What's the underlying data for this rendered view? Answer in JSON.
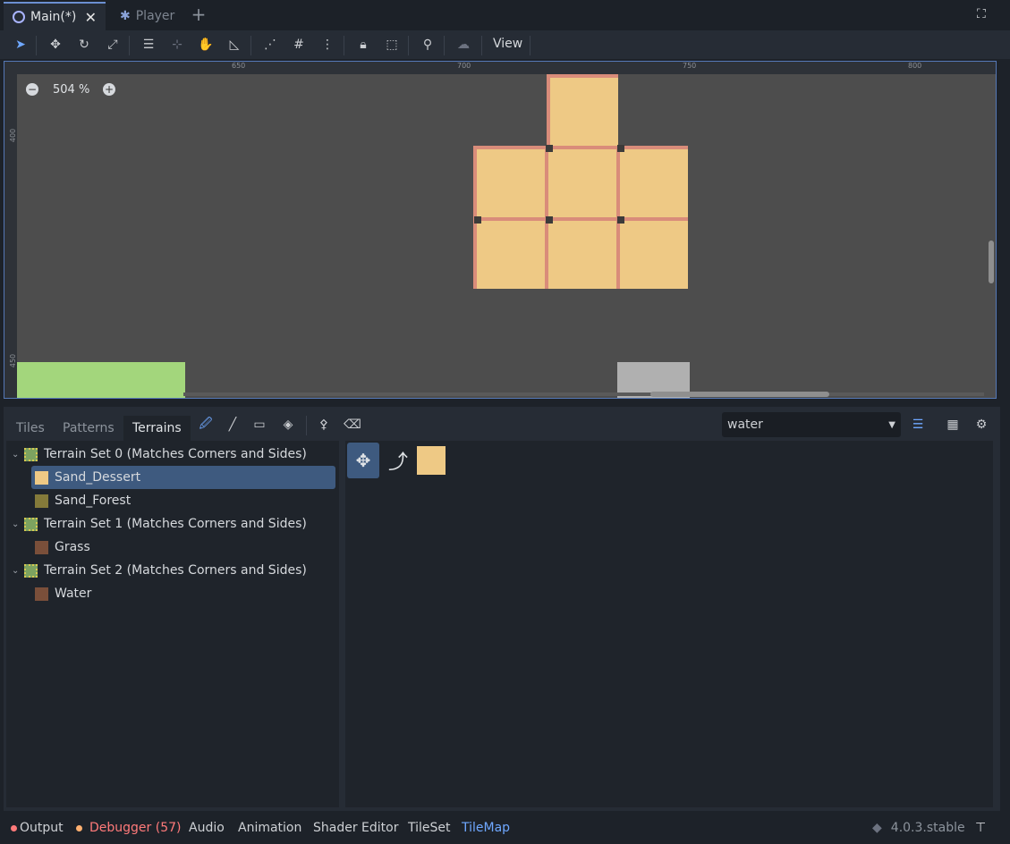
{
  "scene_tabs": [
    {
      "label": "Main(*)",
      "icon": "scene-node-icon",
      "closable": true
    },
    {
      "label": "Player",
      "icon": "character-icon",
      "closable": false
    }
  ],
  "toolbar": {
    "view_label": "View"
  },
  "viewport": {
    "zoom_label": "504 %",
    "ruler_top": [
      "650",
      "700",
      "750",
      "800"
    ],
    "ruler_left": [
      "400",
      "450"
    ]
  },
  "panel": {
    "tabs": [
      "Tiles",
      "Patterns",
      "Terrains"
    ],
    "active_tab": "Terrains",
    "layer_select_value": "water",
    "terrain_tree": [
      {
        "label": "Terrain Set 0 (Matches Corners and Sides)",
        "children": [
          {
            "label": "Sand_Dessert",
            "color": "#eec985",
            "selected": true
          },
          {
            "label": "Sand_Forest",
            "color": "#847a3a"
          }
        ]
      },
      {
        "label": "Terrain Set 1 (Matches Corners and Sides)",
        "children": [
          {
            "label": "Grass",
            "color": "#7a4f3a"
          }
        ]
      },
      {
        "label": "Terrain Set 2 (Matches Corners and Sides)",
        "children": [
          {
            "label": "Water",
            "color": "#7a4f3a"
          }
        ]
      }
    ]
  },
  "statusbar": {
    "items": [
      "Output",
      "Debugger (57)",
      "Audio",
      "Animation",
      "Shader Editor",
      "TileSet",
      "TileMap"
    ],
    "active": "TileMap",
    "version": "4.0.3.stable"
  },
  "colors": {
    "accent": "#6fa8ff",
    "debugger_red": "#ff7a7a",
    "sand": "#eec985",
    "grass": "#a3d67c"
  }
}
